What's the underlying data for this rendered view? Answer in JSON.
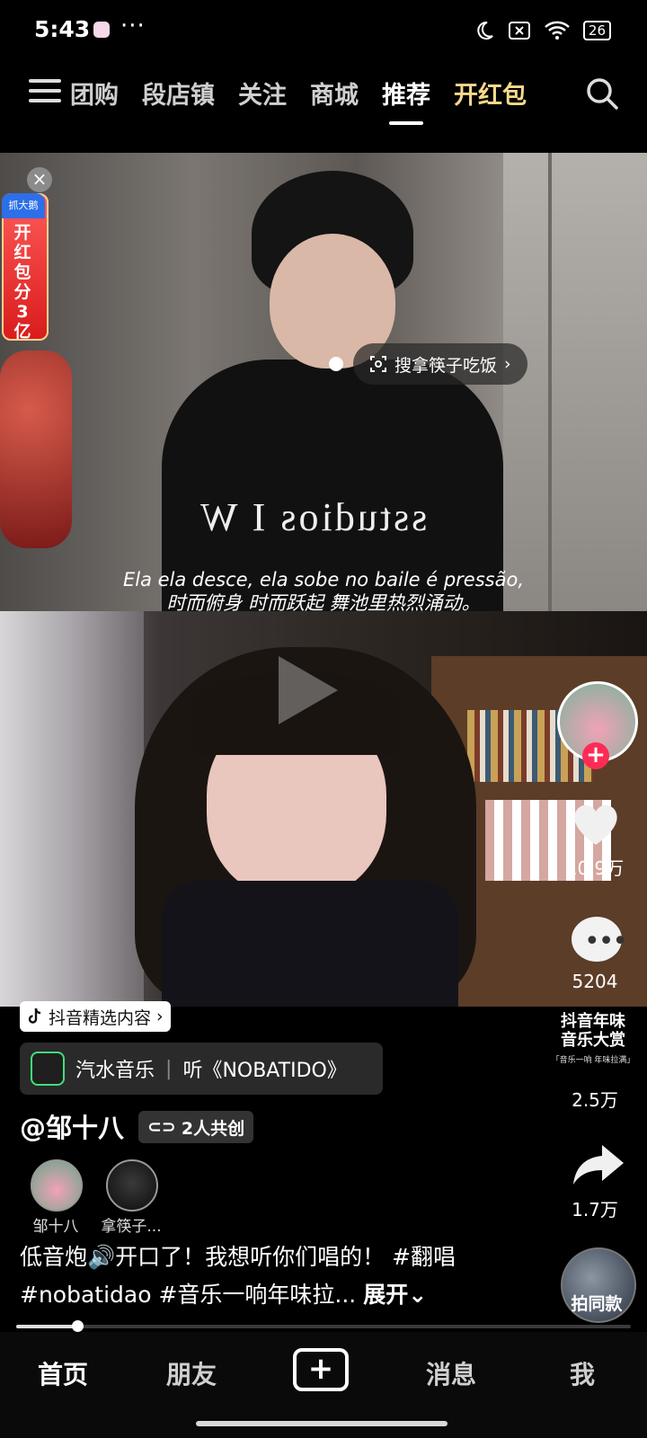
{
  "status_bar": {
    "time": "5:43",
    "dots": "···",
    "battery": "26"
  },
  "top_nav": {
    "tabs": [
      {
        "label": "团购"
      },
      {
        "label": "段店镇"
      },
      {
        "label": "关注"
      },
      {
        "label": "商城"
      },
      {
        "label": "推荐"
      },
      {
        "label": "开红包"
      }
    ],
    "active_tab": "推荐",
    "accent_color": "#f6d98b"
  },
  "video": {
    "red_packet_top": "抓大鹅",
    "red_packet_text": "开红包分3亿",
    "search_pill": "搜拿筷子吃饭",
    "shirt_text": "sstudios I W",
    "subtitle_line1": "Ela ela desce, ela sobe no baile é pressão,",
    "subtitle_line2": "时而俯身 时而跃起 舞池里热烈涌动。"
  },
  "actions": {
    "likes": "10.9万",
    "comments": "5204",
    "award_line1": "抖音年味",
    "award_line2": "音乐大赏",
    "award_sub": "「音乐一响 年味拉满」",
    "favorites": "2.5万",
    "shares": "1.7万",
    "remix_label": "拍同款",
    "follow_symbol": "+"
  },
  "info": {
    "badge": "抖音精选内容",
    "music_app": "汽水音乐",
    "music_sep": "|",
    "music_title": "听《NOBATIDO》",
    "author": "@邹十八",
    "cocreate": "2人共创",
    "co_creators": [
      {
        "name": "邹十八"
      },
      {
        "name": "拿筷子..."
      }
    ],
    "desc_line1": "低音炮🔊开口了！我想听你们唱的！ #翻唱",
    "desc_line2": "#nobatidao #音乐一响年味拉...",
    "expand": "展开",
    "progress_fraction": 0.1
  },
  "bottom_nav": {
    "items": [
      {
        "label": "首页"
      },
      {
        "label": "朋友"
      },
      {
        "label": "+"
      },
      {
        "label": "消息"
      },
      {
        "label": "我"
      }
    ],
    "active": "首页"
  },
  "colors": {
    "like_red": "#fe2c55",
    "background": "#000000"
  }
}
